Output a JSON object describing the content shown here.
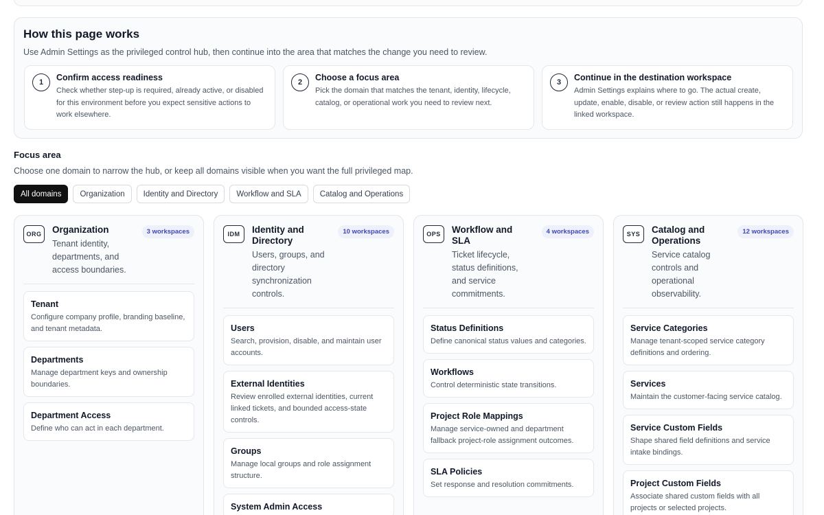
{
  "how": {
    "title": "How this page works",
    "subtitle": "Use Admin Settings as the privileged control hub, then continue into the area that matches the change you need to review.",
    "steps": [
      {
        "num": "1",
        "title": "Confirm access readiness",
        "desc": "Check whether step-up is required, already active, or disabled for this environment before you expect sensitive actions to work elsewhere."
      },
      {
        "num": "2",
        "title": "Choose a focus area",
        "desc": "Pick the domain that matches the tenant, identity, lifecycle, catalog, or operational work you need to review next."
      },
      {
        "num": "3",
        "title": "Continue in the destination workspace",
        "desc": "Admin Settings explains where to go. The actual create, update, enable, disable, or review action still happens in the linked workspace."
      }
    ]
  },
  "focus": {
    "label": "Focus area",
    "subtitle": "Choose one domain to narrow the hub, or keep all domains visible when you want the full privileged map.",
    "filters": [
      "All domains",
      "Organization",
      "Identity and Directory",
      "Workflow and SLA",
      "Catalog and Operations"
    ],
    "active_filter": "All domains"
  },
  "domains": [
    {
      "code": "ORG",
      "title": "Organization",
      "badge": "3 workspaces",
      "desc": "Tenant identity, departments, and access boundaries.",
      "workspaces": [
        {
          "title": "Tenant",
          "desc": "Configure company profile, branding baseline, and tenant metadata."
        },
        {
          "title": "Departments",
          "desc": "Manage department keys and ownership boundaries."
        },
        {
          "title": "Department Access",
          "desc": "Define who can act in each department."
        }
      ]
    },
    {
      "code": "IDM",
      "title": "Identity and Directory",
      "badge": "10 workspaces",
      "desc": "Users, groups, and directory synchronization controls.",
      "workspaces": [
        {
          "title": "Users",
          "desc": "Search, provision, disable, and maintain user accounts."
        },
        {
          "title": "External Identities",
          "desc": "Review enrolled external identities, current linked tickets, and bounded access-state controls."
        },
        {
          "title": "Groups",
          "desc": "Manage local groups and role assignment structure."
        },
        {
          "title": "System Admin Access",
          "desc": ""
        }
      ]
    },
    {
      "code": "OPS",
      "title": "Workflow and SLA",
      "badge": "4 workspaces",
      "desc": "Ticket lifecycle, status definitions, and service commitments.",
      "workspaces": [
        {
          "title": "Status Definitions",
          "desc": "Define canonical status values and categories."
        },
        {
          "title": "Workflows",
          "desc": "Control deterministic state transitions."
        },
        {
          "title": "Project Role Mappings",
          "desc": "Manage service-owned and department fallback project-role assignment outcomes."
        },
        {
          "title": "SLA Policies",
          "desc": "Set response and resolution commitments."
        }
      ]
    },
    {
      "code": "SYS",
      "title": "Catalog and Operations",
      "badge": "12 workspaces",
      "desc": "Service catalog controls and operational observability.",
      "workspaces": [
        {
          "title": "Service Categories",
          "desc": "Manage tenant-scoped service category definitions and ordering."
        },
        {
          "title": "Services",
          "desc": "Maintain the customer-facing service catalog."
        },
        {
          "title": "Service Custom Fields",
          "desc": "Shape shared field definitions and service intake bindings."
        },
        {
          "title": "Project Custom Fields",
          "desc": "Associate shared custom fields with all projects or selected projects."
        }
      ]
    }
  ]
}
